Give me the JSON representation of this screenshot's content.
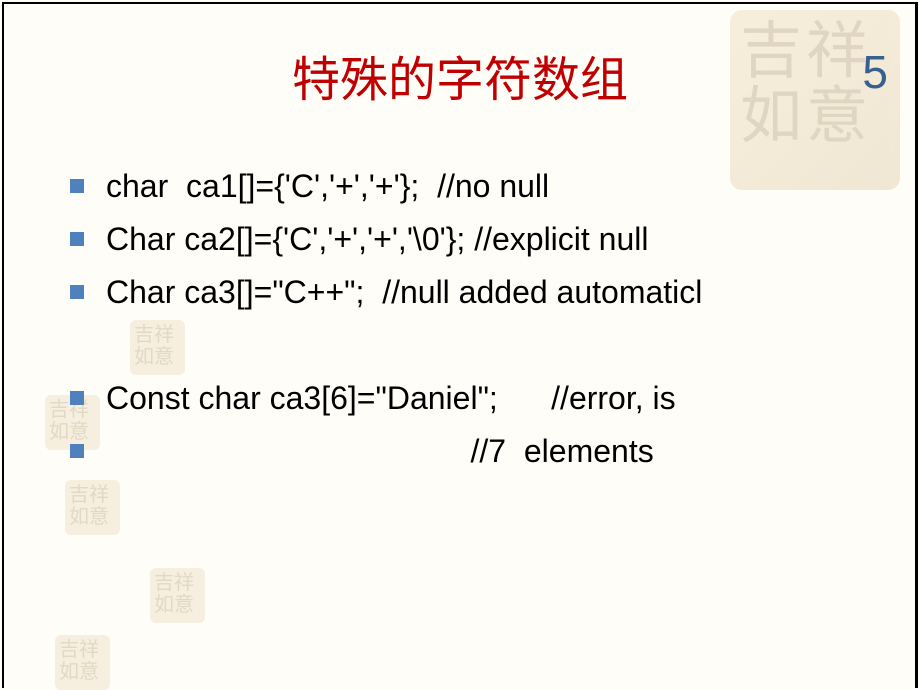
{
  "title": "特殊的字符数组",
  "page_number": "5",
  "bullets": [
    "char  ca1[]={'C','+','+'};  //no null",
    "Char ca2[]={'C','+','+','\\0'}; //explicit null",
    "Char ca3[]=\"C++\";  //null added automaticl",
    "",
    "Const char ca3[6]=\"Daniel\";      //error, is",
    "                                         //7  elements"
  ]
}
